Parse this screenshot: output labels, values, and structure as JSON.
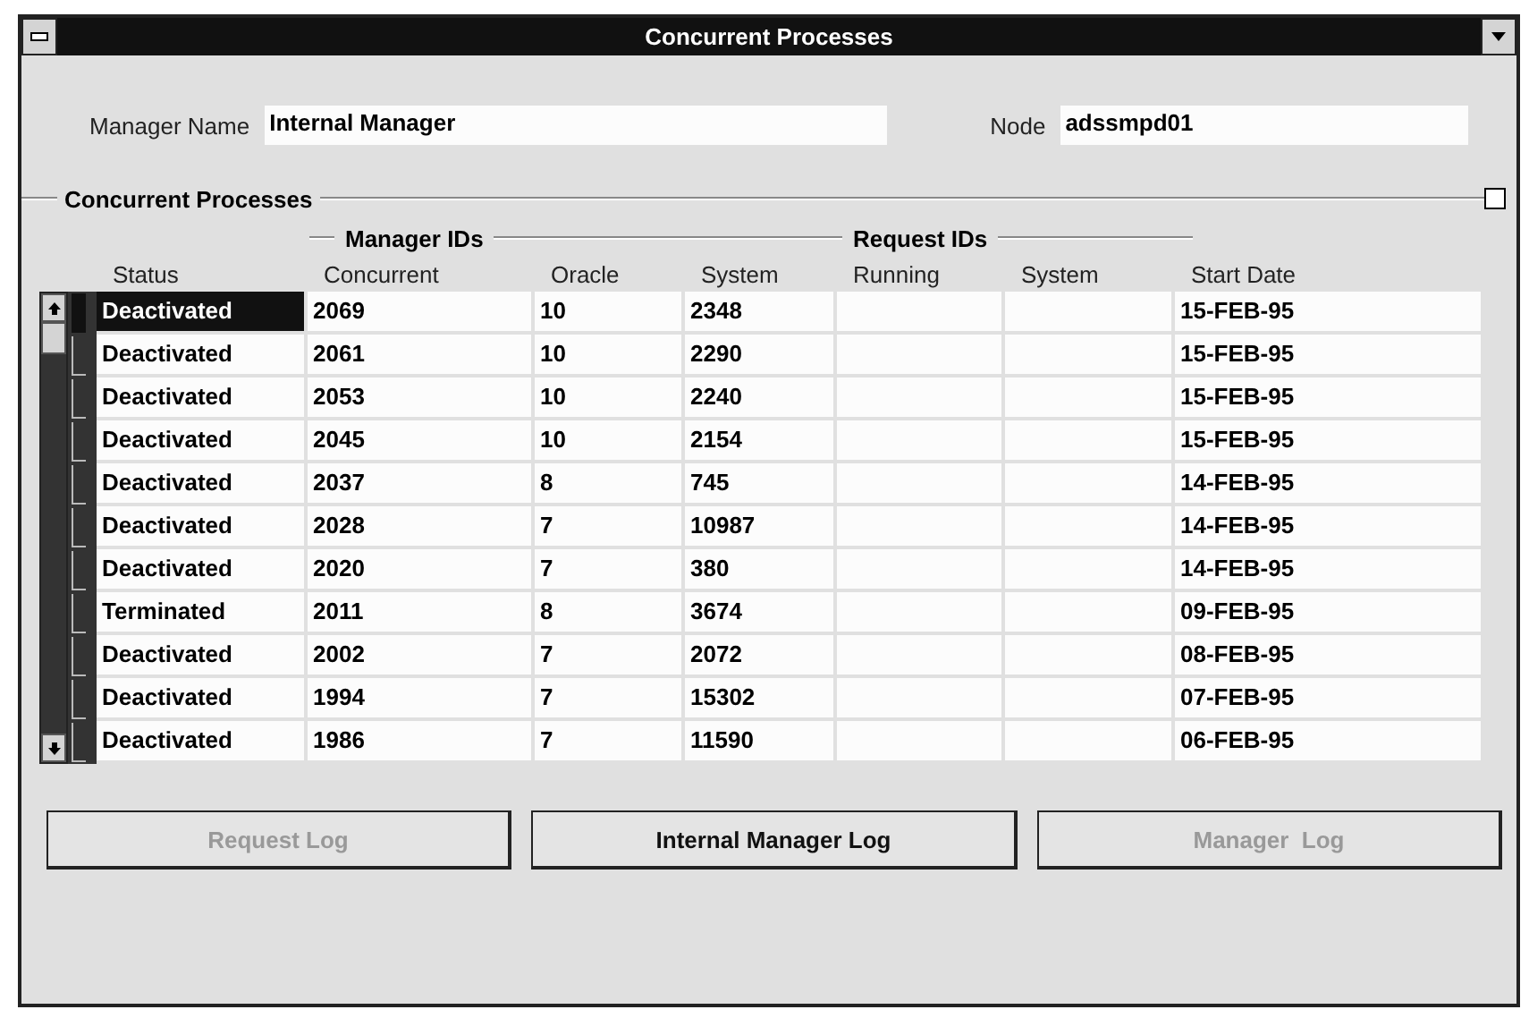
{
  "window": {
    "title": "Concurrent Processes"
  },
  "fields": [
    {
      "label": "Manager Name",
      "value": "Internal Manager"
    },
    {
      "label": "Node",
      "value": "adssmpd01"
    }
  ],
  "section": {
    "title": "Concurrent Processes",
    "checked": false
  },
  "column_groups": [
    {
      "label": "Manager IDs"
    },
    {
      "label": "Request IDs"
    }
  ],
  "table": {
    "columns": [
      "Status",
      "Concurrent",
      "Oracle",
      "System",
      "Running",
      "System",
      "Start Date"
    ],
    "rows": [
      {
        "cells": [
          "Deactivated",
          "2069",
          "10",
          "2348",
          "",
          "",
          "15-FEB-95"
        ],
        "selected": true
      },
      {
        "cells": [
          "Deactivated",
          "2061",
          "10",
          "2290",
          "",
          "",
          "15-FEB-95"
        ],
        "selected": false
      },
      {
        "cells": [
          "Deactivated",
          "2053",
          "10",
          "2240",
          "",
          "",
          "15-FEB-95"
        ],
        "selected": false
      },
      {
        "cells": [
          "Deactivated",
          "2045",
          "10",
          "2154",
          "",
          "",
          "15-FEB-95"
        ],
        "selected": false
      },
      {
        "cells": [
          "Deactivated",
          "2037",
          "8",
          "745",
          "",
          "",
          "14-FEB-95"
        ],
        "selected": false
      },
      {
        "cells": [
          "Deactivated",
          "2028",
          "7",
          "10987",
          "",
          "",
          "14-FEB-95"
        ],
        "selected": false
      },
      {
        "cells": [
          "Deactivated",
          "2020",
          "7",
          "380",
          "",
          "",
          "14-FEB-95"
        ],
        "selected": false
      },
      {
        "cells": [
          "Terminated",
          "2011",
          "8",
          "3674",
          "",
          "",
          "09-FEB-95"
        ],
        "selected": false
      },
      {
        "cells": [
          "Deactivated",
          "2002",
          "7",
          "2072",
          "",
          "",
          "08-FEB-95"
        ],
        "selected": false
      },
      {
        "cells": [
          "Deactivated",
          "1994",
          "7",
          "15302",
          "",
          "",
          "07-FEB-95"
        ],
        "selected": false
      },
      {
        "cells": [
          "Deactivated",
          "1986",
          "7",
          "11590",
          "",
          "",
          "06-FEB-95"
        ],
        "selected": false
      }
    ]
  },
  "buttons": [
    {
      "label": "Request Log",
      "disabled": true
    },
    {
      "label": "Internal Manager Log",
      "disabled": false
    },
    {
      "label": "Manager  Log",
      "disabled": true
    }
  ]
}
